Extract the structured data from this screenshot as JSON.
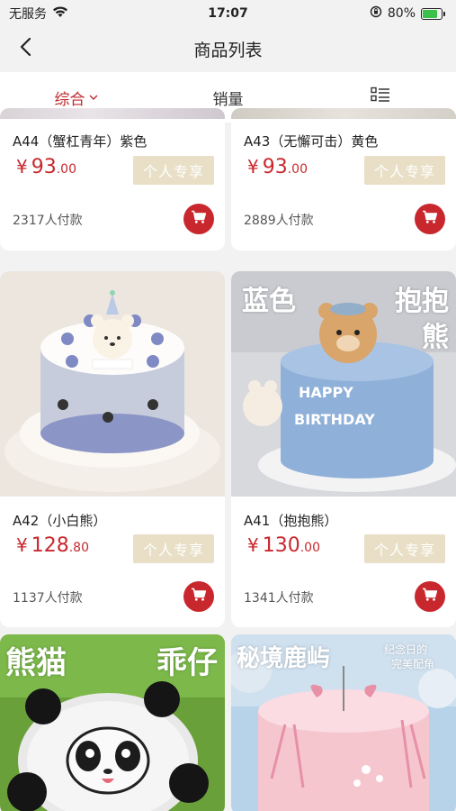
{
  "status_bar": {
    "carrier": "无服务",
    "time": "17:07",
    "battery_percent": "80%",
    "battery_level": 0.8
  },
  "nav": {
    "title": "商品列表",
    "back_icon": "chevron-left-icon"
  },
  "tabs": [
    {
      "label": "综合",
      "active": true,
      "icon": "chevron-down-icon"
    },
    {
      "label": "销量",
      "active": false
    },
    {
      "label": "",
      "icon": "list-view-icon"
    }
  ],
  "products": [
    {
      "name": "A44（蟹杠青年）紫色",
      "price_int": "93",
      "price_dec": ".00",
      "currency": "¥",
      "tag": "个人专享",
      "paid": "2317人付款"
    },
    {
      "name": "A43（无懈可击）黄色",
      "price_int": "93",
      "price_dec": ".00",
      "currency": "¥",
      "tag": "个人专享",
      "paid": "2889人付款"
    },
    {
      "name": "A42（小白熊）",
      "price_int": "128",
      "price_dec": ".80",
      "currency": "¥",
      "tag": "个人专享",
      "paid": "1137人付款",
      "image_overlay": []
    },
    {
      "name": "A41（抱抱熊）",
      "price_int": "130",
      "price_dec": ".00",
      "currency": "¥",
      "tag": "个人专享",
      "paid": "1341人付款",
      "image_overlay": [
        "蓝色",
        "抱抱",
        "熊"
      ]
    },
    {
      "name": "",
      "image_overlay": [
        "熊猫",
        "乖仔"
      ]
    },
    {
      "name": "",
      "image_overlay": [
        "秘境鹿屿",
        "纪念日的",
        "完美配角"
      ]
    }
  ],
  "colors": {
    "accent": "#c8282d",
    "tag_bg": "#e8dfc6",
    "page_bg": "#f2f2f2"
  }
}
